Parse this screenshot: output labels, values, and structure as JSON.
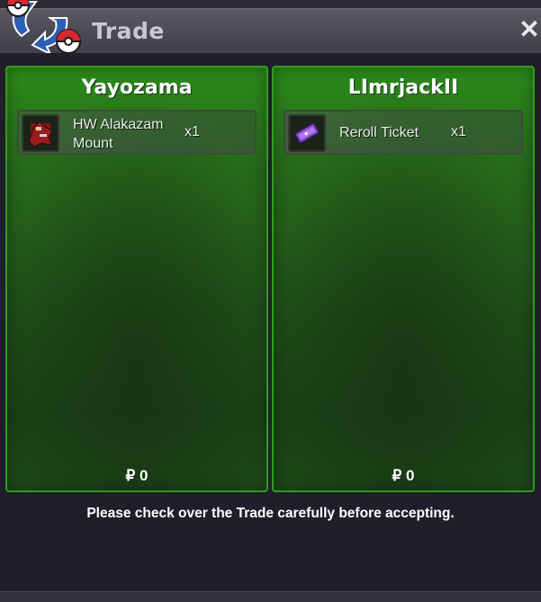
{
  "window": {
    "title": "Trade",
    "close_glyph": "✕"
  },
  "left_party": {
    "name": "Yayozama",
    "items": [
      {
        "name_line1": "HW Alakazam",
        "name_line2": "Mount",
        "quantity": "x1",
        "icon": "alakazam-mount-icon"
      }
    ],
    "money_symbol": "₽",
    "money": "0"
  },
  "right_party": {
    "name": "LImrjackII",
    "items": [
      {
        "name": "Reroll Ticket",
        "quantity": "x1",
        "icon": "reroll-ticket-icon"
      }
    ],
    "money_symbol": "₽",
    "money": "0"
  },
  "notice": "Please check over the Trade carefully before accepting.",
  "colors": {
    "panel_border": "#2f9c1c",
    "panel_top": "#2c8c1a",
    "panel_bottom": "#1b4117",
    "background": "#201e2a"
  }
}
